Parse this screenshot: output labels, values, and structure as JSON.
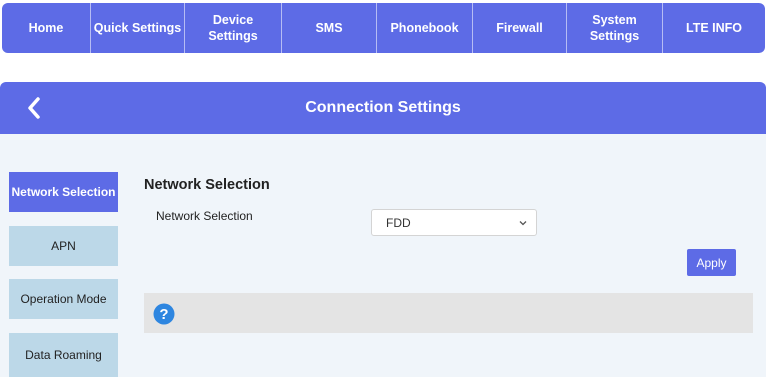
{
  "nav": {
    "items": [
      {
        "label": "Home"
      },
      {
        "label": "Quick Settings"
      },
      {
        "label": "Device Settings"
      },
      {
        "label": "SMS"
      },
      {
        "label": "Phonebook"
      },
      {
        "label": "Firewall"
      },
      {
        "label": "System\nSettings"
      },
      {
        "label": "LTE INFO"
      }
    ]
  },
  "header": {
    "title": "Connection Settings",
    "back_icon": "chevron-left-icon"
  },
  "sidebar": {
    "items": [
      {
        "label": "Network Selection",
        "active": true
      },
      {
        "label": "APN"
      },
      {
        "label": "Operation Mode"
      },
      {
        "label": "Data Roaming"
      }
    ]
  },
  "main": {
    "section_title": "Network Selection",
    "field_label": "Network Selection",
    "select_value": "FDD",
    "apply_label": "Apply",
    "help_icon": "question-circle-icon"
  },
  "colors": {
    "accent": "#5d6be6",
    "sidebar_inactive": "#bcd8e8",
    "panel_bg": "#f0f5fa",
    "help_bar": "#e4e4e4",
    "help_icon": "#2e86e0"
  }
}
